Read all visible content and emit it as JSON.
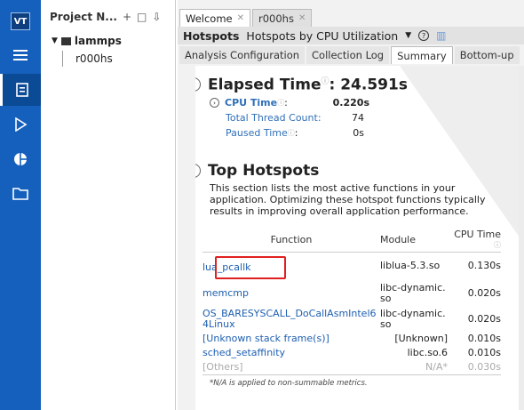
{
  "rail": {
    "logo_text": "VT",
    "icons": [
      "menu-icon",
      "clipboard-icon",
      "play-icon",
      "pie-chart-icon",
      "folder-icon"
    ]
  },
  "project": {
    "header": "Project N...",
    "tools": [
      "+",
      "□",
      "⇩"
    ],
    "root": "lammps",
    "child": "r000hs"
  },
  "tabs": [
    {
      "label": "Welcome"
    },
    {
      "label": "r000hs"
    }
  ],
  "analysis": {
    "title": "Hotspots",
    "subtitle": "Hotspots by CPU Utilization"
  },
  "subtabs": [
    "Analysis Configuration",
    "Collection Log",
    "Summary",
    "Bottom-up"
  ],
  "summary": {
    "elapsed_label": "Elapsed Time",
    "elapsed_value": ": 24.591s",
    "cpu_time_label": "CPU Time",
    "cpu_time_value": "0.220s",
    "thread_count_label": "Total Thread Count:",
    "thread_count_value": "74",
    "paused_label": "Paused Time",
    "paused_value": "0s",
    "hotspots_title": "Top Hotspots",
    "hotspots_desc": "This section lists the most active functions in your application. Optimizing these hotspot functions typically results in improving overall application performance.",
    "columns": {
      "function": "Function",
      "module": "Module",
      "cpu_time": "CPU Time"
    },
    "rows": [
      {
        "function": "lua_pcallk",
        "module": "liblua-5.3.so",
        "cpu": "0.130s"
      },
      {
        "function": "memcmp",
        "module": "libc-dynamic.so",
        "cpu": "0.020s"
      },
      {
        "function": "OS_BARESYSCALL_DoCallAsmIntel64Linux",
        "module": "libc-dynamic.so",
        "cpu": "0.020s"
      },
      {
        "function": "[Unknown stack frame(s)]",
        "module": "[Unknown]",
        "cpu": "0.010s"
      },
      {
        "function": "sched_setaffinity",
        "module": "libc.so.6",
        "cpu": "0.010s"
      },
      {
        "function": "[Others]",
        "module": "N/A*",
        "cpu": "0.030s"
      }
    ],
    "note": "*N/A is applied to non-summable metrics."
  }
}
